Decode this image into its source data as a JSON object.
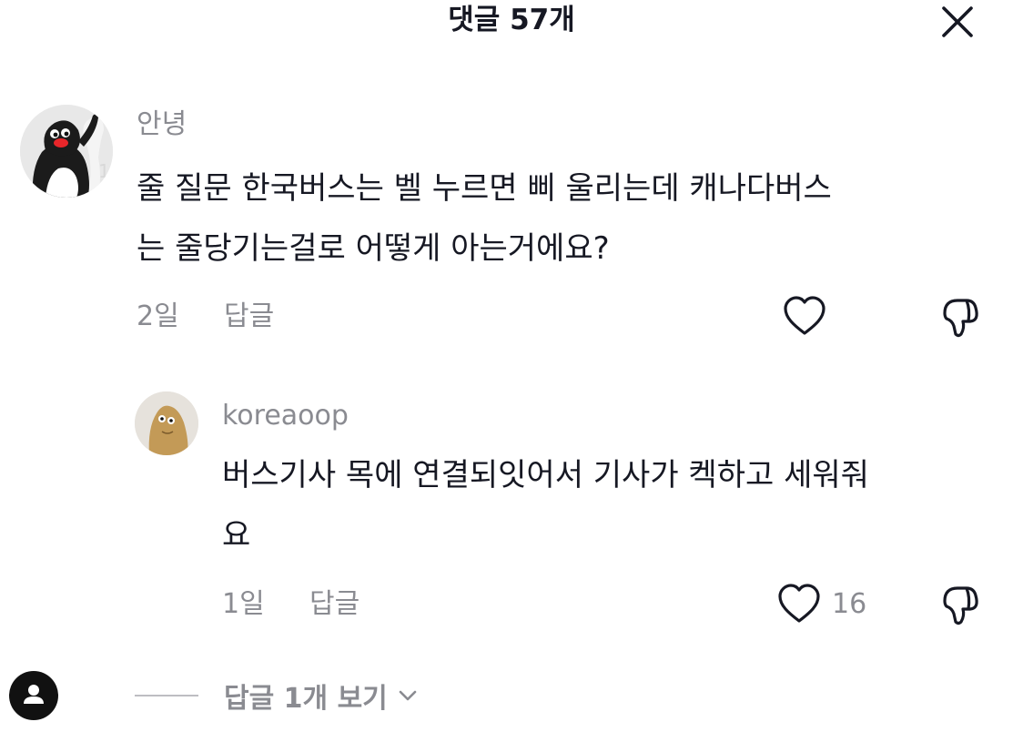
{
  "header": {
    "title": "댓글 57개"
  },
  "comments": [
    {
      "username": "안녕",
      "lines": [
        "줄 질문 한국버스는 벨 누르면 삐 울리는데 캐나다버스",
        "는 줄당기는걸로 어떻게 아는거에요?"
      ],
      "time": "2일",
      "reply_label": "답글",
      "like_icon": "heart-icon",
      "dislike_icon": "thumbs-down-icon"
    },
    {
      "username": "koreaoop",
      "lines": [
        "버스기사 목에 연결되잇어서 기사가 켁하고 세워줘",
        "요"
      ],
      "time": "1일",
      "reply_label": "답글",
      "like_count": "16",
      "like_icon": "heart-icon",
      "dislike_icon": "thumbs-down-icon"
    }
  ],
  "view_replies": {
    "label": "답글 1개 보기"
  },
  "colors": {
    "text": "#161823",
    "secondary": "#8a8b91"
  }
}
